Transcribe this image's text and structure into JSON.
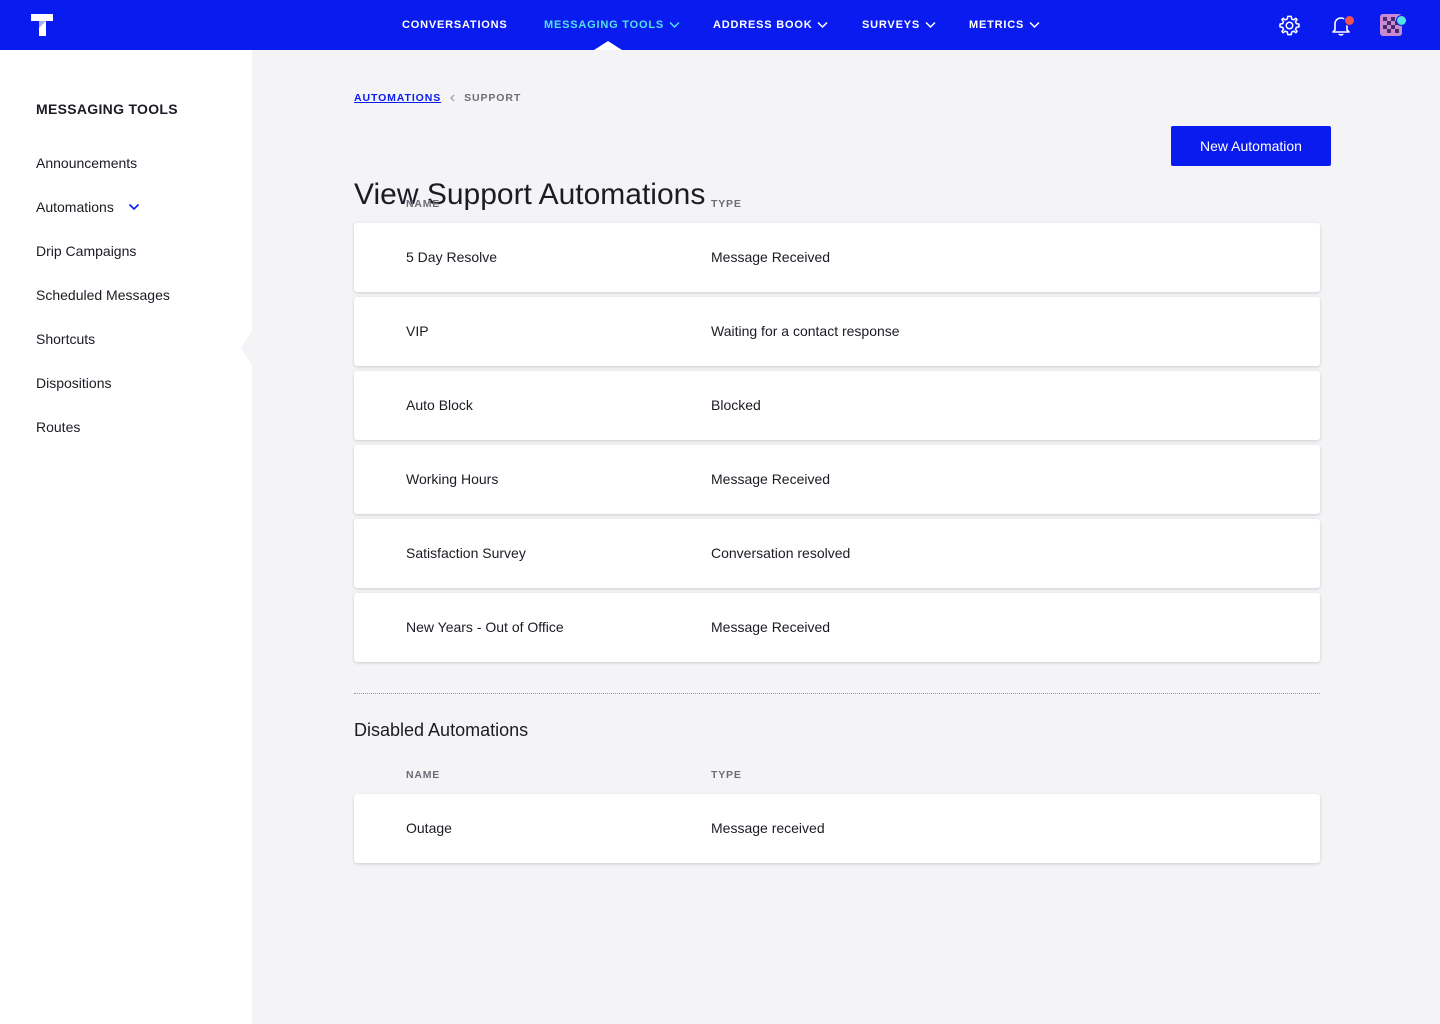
{
  "topnav": {
    "items": [
      {
        "label": "CONVERSATIONS",
        "has_dropdown": false,
        "active": false
      },
      {
        "label": "MESSAGING TOOLS",
        "has_dropdown": true,
        "active": true
      },
      {
        "label": "ADDRESS BOOK",
        "has_dropdown": true,
        "active": false
      },
      {
        "label": "SURVEYS",
        "has_dropdown": true,
        "active": false
      },
      {
        "label": "METRICS",
        "has_dropdown": true,
        "active": false
      }
    ],
    "icons": [
      "logo-icon",
      "gear-icon",
      "bell-icon",
      "avatar"
    ],
    "colors": {
      "bar": "#0a1bf0",
      "active": "#52e3e6",
      "bell_badge": "#f0524d",
      "avatar_badge": "#52e3e6"
    }
  },
  "sidebar": {
    "title": "MESSAGING TOOLS",
    "items": [
      {
        "label": "Announcements"
      },
      {
        "label": "Automations",
        "expanded": true
      },
      {
        "label": "Drip Campaigns"
      },
      {
        "label": "Scheduled Messages"
      },
      {
        "label": "Shortcuts"
      },
      {
        "label": "Dispositions"
      },
      {
        "label": "Routes"
      }
    ]
  },
  "breadcrumb": {
    "link": "AUTOMATIONS",
    "current": "SUPPORT"
  },
  "new_button": {
    "label": "New Automation"
  },
  "page_title": "View Support Automations",
  "active_table": {
    "columns": [
      "NAME",
      "TYPE"
    ],
    "rows": [
      {
        "name": "5 Day Resolve",
        "type": "Message Received"
      },
      {
        "name": "VIP",
        "type": "Waiting for a contact response"
      },
      {
        "name": "Auto Block",
        "type": "Blocked"
      },
      {
        "name": "Working Hours",
        "type": "Message Received"
      },
      {
        "name": "Satisfaction Survey",
        "type": "Conversation resolved"
      },
      {
        "name": "New Years - Out of Office",
        "type": "Message Received"
      }
    ]
  },
  "disabled_section": {
    "title": "Disabled Automations",
    "columns": [
      "NAME",
      "TYPE"
    ],
    "rows": [
      {
        "name": "Outage",
        "type": "Message received"
      }
    ]
  }
}
